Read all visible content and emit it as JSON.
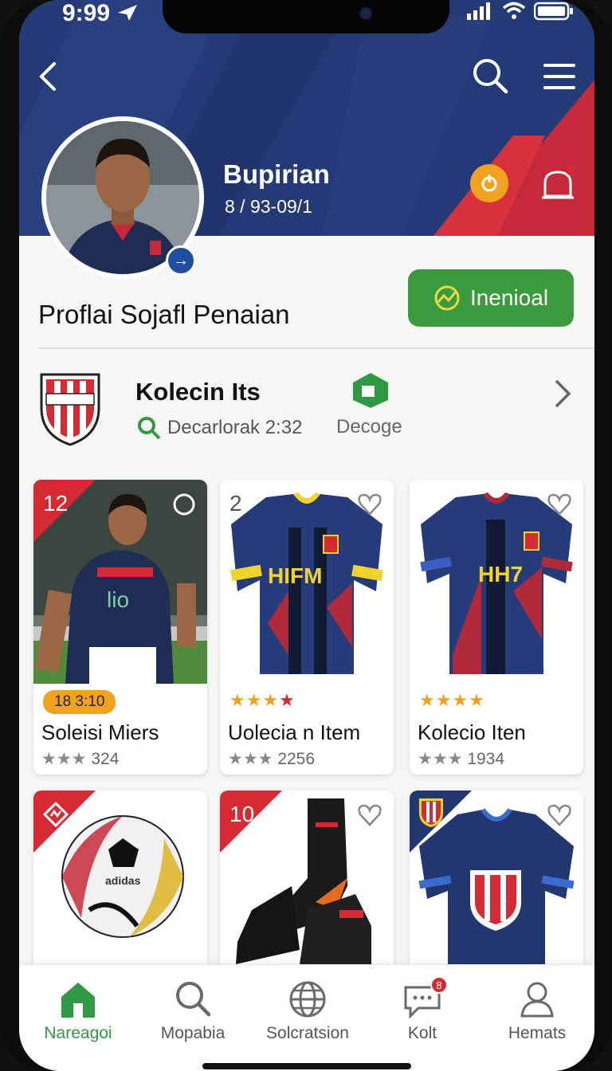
{
  "status": {
    "time": "9:99"
  },
  "hero": {
    "name": "Bupirian",
    "sub": "8 / 93-09/1"
  },
  "profile": {
    "title": "Proflai Sojafl Penaian",
    "cta_label": "Inenioal"
  },
  "collection": {
    "title": "Kolecin Its",
    "sub": "Decarlorak 2:32",
    "tag": "Decoge"
  },
  "cards": [
    {
      "corner": "12",
      "badge": "18 3:10",
      "title": "Soleisi Miers",
      "count": "324"
    },
    {
      "corner": "2",
      "title": "Uolecia n Item",
      "count": "2256",
      "stars_red": 1
    },
    {
      "corner": "",
      "title": "Kolecio Iten",
      "count": "1934"
    },
    {
      "corner": ""
    },
    {
      "corner": "10"
    },
    {
      "corner": ""
    }
  ],
  "jersey_text": {
    "c2": "HIFM",
    "c3": "HH7"
  },
  "tabs": [
    {
      "label": "Nareagoi",
      "icon": "home-icon"
    },
    {
      "label": "Mopabia",
      "icon": "search-icon"
    },
    {
      "label": "Solcratsion",
      "icon": "globe-icon"
    },
    {
      "label": "Kolt",
      "icon": "chat-icon",
      "badge": "8"
    },
    {
      "label": "Hemats",
      "icon": "profile-icon"
    }
  ],
  "colors": {
    "navy": "#243a73",
    "red": "#d52a34",
    "green": "#3a9a3c",
    "orange": "#f0a21f"
  }
}
